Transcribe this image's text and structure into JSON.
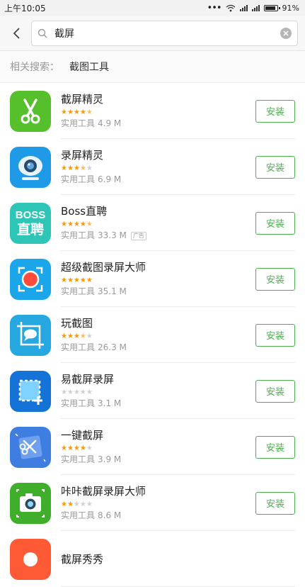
{
  "status_bar": {
    "time": "上午10:05",
    "battery": "91%",
    "battery_level": 0.91
  },
  "search": {
    "query": "截屏"
  },
  "related": {
    "label": "相关搜索：",
    "keyword": "截图工具"
  },
  "apps": [
    {
      "name": "截屏精灵",
      "rating": 4.5,
      "category": "实用工具",
      "size": "4.9 M",
      "ad": "",
      "button": "安装",
      "icon": "scissors-icon",
      "color": "#56bf2c"
    },
    {
      "name": "录屏精灵",
      "rating": 3.5,
      "category": "实用工具",
      "size": "6.9 M",
      "ad": "",
      "button": "安装",
      "icon": "webcam-icon",
      "color": "#1e9ae6"
    },
    {
      "name": "Boss直聘",
      "rating": 4.5,
      "category": "实用工具",
      "size": "33.3 M",
      "ad": "广告",
      "button": "安装",
      "icon": "boss-logo-icon",
      "color": "#2ec4b6",
      "icon_text_top": "BOSS",
      "icon_text_bottom": "直聘"
    },
    {
      "name": "超级截图录屏大师",
      "rating": 5,
      "category": "实用工具",
      "size": "35.1 M",
      "ad": "",
      "button": "安装",
      "icon": "record-dot-icon",
      "color": "#1aa6e8"
    },
    {
      "name": "玩截图",
      "rating": 3.5,
      "category": "实用工具",
      "size": "26.3 M",
      "ad": "",
      "button": "安装",
      "icon": "crop-chat-icon",
      "color": "#27a7e0"
    },
    {
      "name": "易截屏录屏",
      "rating": 0,
      "category": "实用工具",
      "size": "3.1 M",
      "ad": "",
      "button": "安装",
      "icon": "selection-frame-icon",
      "color": "#1573d8"
    },
    {
      "name": "一键截屏",
      "rating": 4,
      "category": "实用工具",
      "size": "3.9 M",
      "ad": "",
      "button": "安装",
      "icon": "scissors-card-icon",
      "color": "#3f7de0"
    },
    {
      "name": "咔咔截屏录屏大师",
      "rating": 2,
      "category": "实用工具",
      "size": "8.6 M",
      "ad": "",
      "button": "安装",
      "icon": "camera-icon",
      "color": "#3fae2a"
    },
    {
      "name": "截屏秀秀",
      "rating": 0,
      "category": "",
      "size": "",
      "ad": "",
      "button": "",
      "icon": "partial-app-icon",
      "color": "#ff5a36"
    }
  ]
}
